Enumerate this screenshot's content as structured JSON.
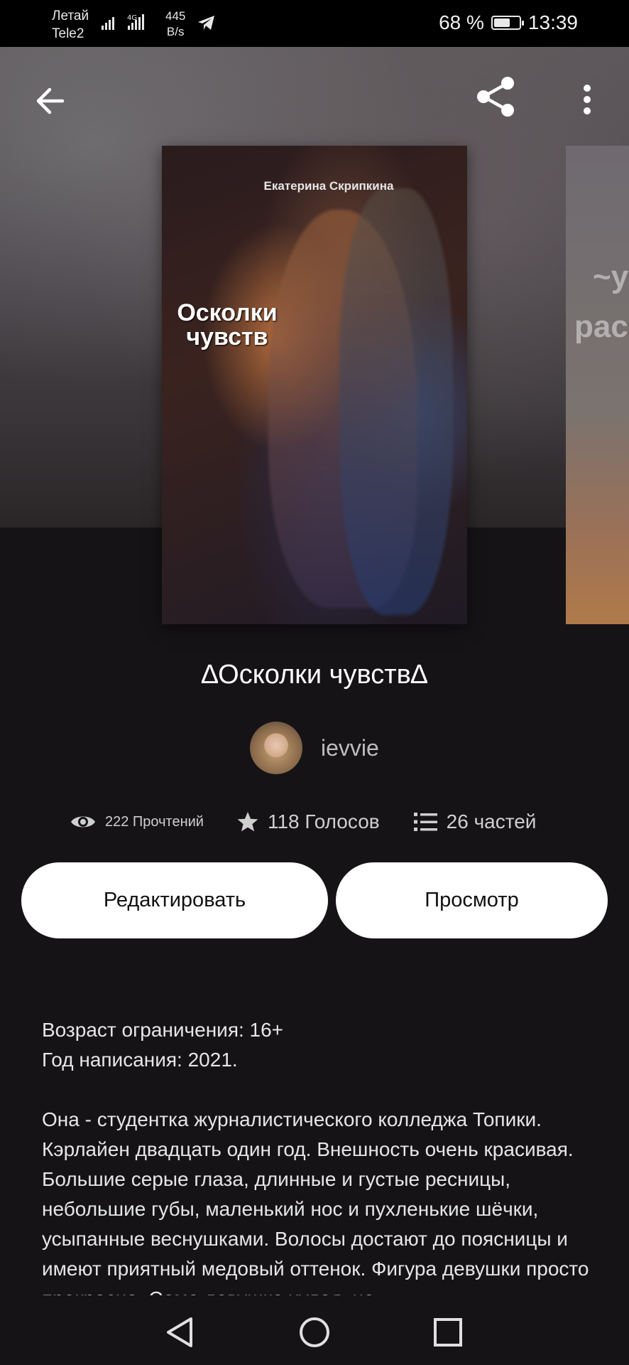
{
  "status_bar": {
    "carrier_1": "Летай",
    "carrier_2": "Tele2",
    "network": "4G",
    "speed_value": "445",
    "speed_unit": "B/s",
    "battery": "68 %",
    "battery_level": 0.68,
    "time": "13:39"
  },
  "cover": {
    "author": "Екатерина Скрипкина",
    "title_line1": "Осколки",
    "title_line2": "чувств",
    "next_line1": "~у",
    "next_line2": "рас"
  },
  "book": {
    "title": "∆Осколки чувств∆",
    "author": "ievvie"
  },
  "stats": {
    "reads": "222 Прочтений",
    "votes": "118 Голосов",
    "parts": "26 частей"
  },
  "buttons": {
    "edit": "Редактировать",
    "view": "Просмотр"
  },
  "description": {
    "line1": "Возраст ограничения: 16+",
    "line2": "Год написания: 2021.",
    "paragraph": "Она - студентка журналистического колледжа Топики. Кэрлайен двадцать один год. Внешность очень красивая. Большие серые глаза, длинные и густые ресницы, небольшие губы, маленький нос и пухленькие шёчки, усыпанные веснушками. Волосы достают до поясницы и имеют приятный медовый оттенок. Фигура девушки просто прекрасна. Сама девушка худая, но"
  },
  "icons": {
    "back": "arrow-left-icon",
    "share": "share-icon",
    "more": "more-vertical-icon",
    "reads": "eye-icon",
    "votes": "star-icon",
    "parts": "list-icon",
    "nav_back": "triangle-back-icon",
    "nav_home": "circle-home-icon",
    "nav_recent": "square-recent-icon"
  }
}
